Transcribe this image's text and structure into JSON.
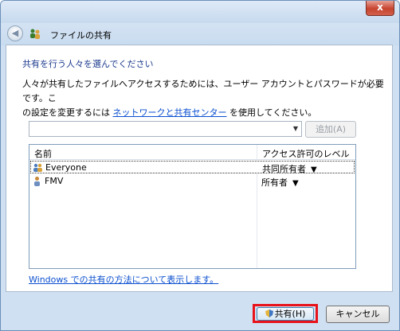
{
  "window": {
    "title": "ファイルの共有",
    "close_label": "x"
  },
  "heading": "共有を行う人々を選んでください",
  "description": {
    "line1": "人々が共有したファイルへアクセスするためには、ユーザー アカウントとパスワードが必要です。こ",
    "line2_prefix": "の設定を変更するには ",
    "link": "ネットワークと共有センター",
    "line2_suffix": " を使用してください。"
  },
  "add_button": "追加(A)",
  "list": {
    "columns": [
      "名前",
      "アクセス許可のレベル"
    ],
    "rows": [
      {
        "name": "Everyone",
        "permission": "共同所有者",
        "icon": "group-icon",
        "selected": true
      },
      {
        "name": "FMV",
        "permission": "所有者",
        "icon": "user-icon",
        "selected": false
      }
    ]
  },
  "learn_link": "Windows での共有の方法について表示します。",
  "buttons": {
    "share": "共有(H)",
    "cancel": "キャンセル"
  },
  "colors": {
    "accent_link": "#0a4fcf",
    "heading": "#1c3a8e",
    "highlight_outline": "#e8121b"
  }
}
